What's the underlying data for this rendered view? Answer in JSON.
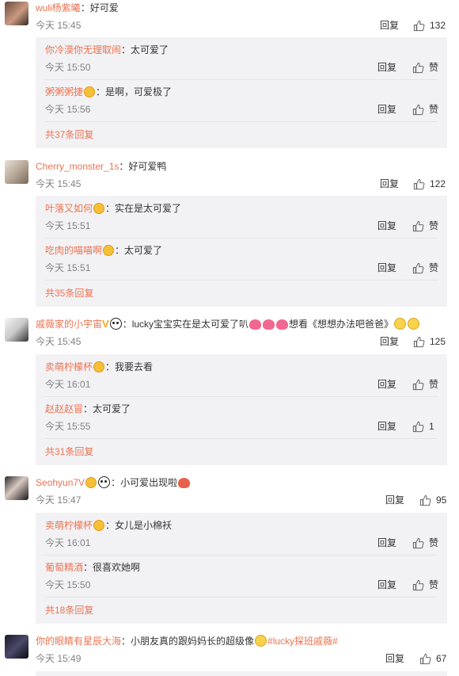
{
  "icons": {
    "like": "thumbs-up-icon",
    "vip": "vip-badge-icon",
    "emoji": "emoji-icon"
  },
  "colors": {
    "username": "#eb7350",
    "meta": "#808080",
    "reply_box": "#f2f2f5"
  },
  "comments": [
    {
      "user": "wuli杨紫曦",
      "text": "好可爱",
      "time": "今天 15:45",
      "reply_label": "回复",
      "likes": "132",
      "replies": [
        {
          "user": "你冷漠你无理取闹",
          "text": "太可爱了",
          "time": "今天 15:50",
          "reply_label": "回复",
          "like_label": "赞"
        },
        {
          "user": "粥粥粥捷",
          "text": "是啊，可爱极了",
          "time": "今天 15:56",
          "reply_label": "回复",
          "like_label": "赞"
        }
      ],
      "more": "共37条回复"
    },
    {
      "user": "Cherry_monster_1s",
      "text": "好可爱鸭",
      "time": "今天 15:45",
      "reply_label": "回复",
      "likes": "122",
      "replies": [
        {
          "user": "叶落又如何",
          "text": "实在是太可爱了",
          "time": "今天 15:51",
          "reply_label": "回复",
          "like_label": "赞"
        },
        {
          "user": "吃肉的喵喵啊",
          "text": "太可爱了",
          "time": "今天 15:51",
          "reply_label": "回复",
          "like_label": "赞"
        }
      ],
      "more": "共35条回复"
    },
    {
      "user": "戚薇家的小宇宙",
      "text": "lucky宝宝实在是太可爱了叭",
      "text2": "想看《想想办法吧爸爸》",
      "time": "今天 15:45",
      "reply_label": "回复",
      "likes": "125",
      "replies": [
        {
          "user": "卖萌柠檬杯",
          "text": "我要去看",
          "time": "今天 16:01",
          "reply_label": "回复",
          "like_label": "赞"
        },
        {
          "user": "赵赵赵冒",
          "text": "太可爱了",
          "time": "今天 15:55",
          "reply_label": "回复",
          "like_label": "1"
        }
      ],
      "more": "共31条回复"
    },
    {
      "user": "Seohyun7V",
      "text": "小可爱出现啦",
      "time": "今天 15:47",
      "reply_label": "回复",
      "likes": "95",
      "replies": [
        {
          "user": "卖萌柠檬杯",
          "text": "女儿是小棉袄",
          "time": "今天 16:01",
          "reply_label": "回复",
          "like_label": "赞"
        },
        {
          "user": "葡萄精酒",
          "text": "很喜欢她啊",
          "time": "今天 15:50",
          "reply_label": "回复",
          "like_label": "赞"
        }
      ],
      "more": "共18条回复"
    },
    {
      "user": "你的眼睛有星辰大海",
      "text": "小朋友真的跟妈妈长的超级像",
      "topic": "#lucky探班戚薇#",
      "time": "今天 15:49",
      "reply_label": "回复",
      "likes": "67"
    }
  ]
}
